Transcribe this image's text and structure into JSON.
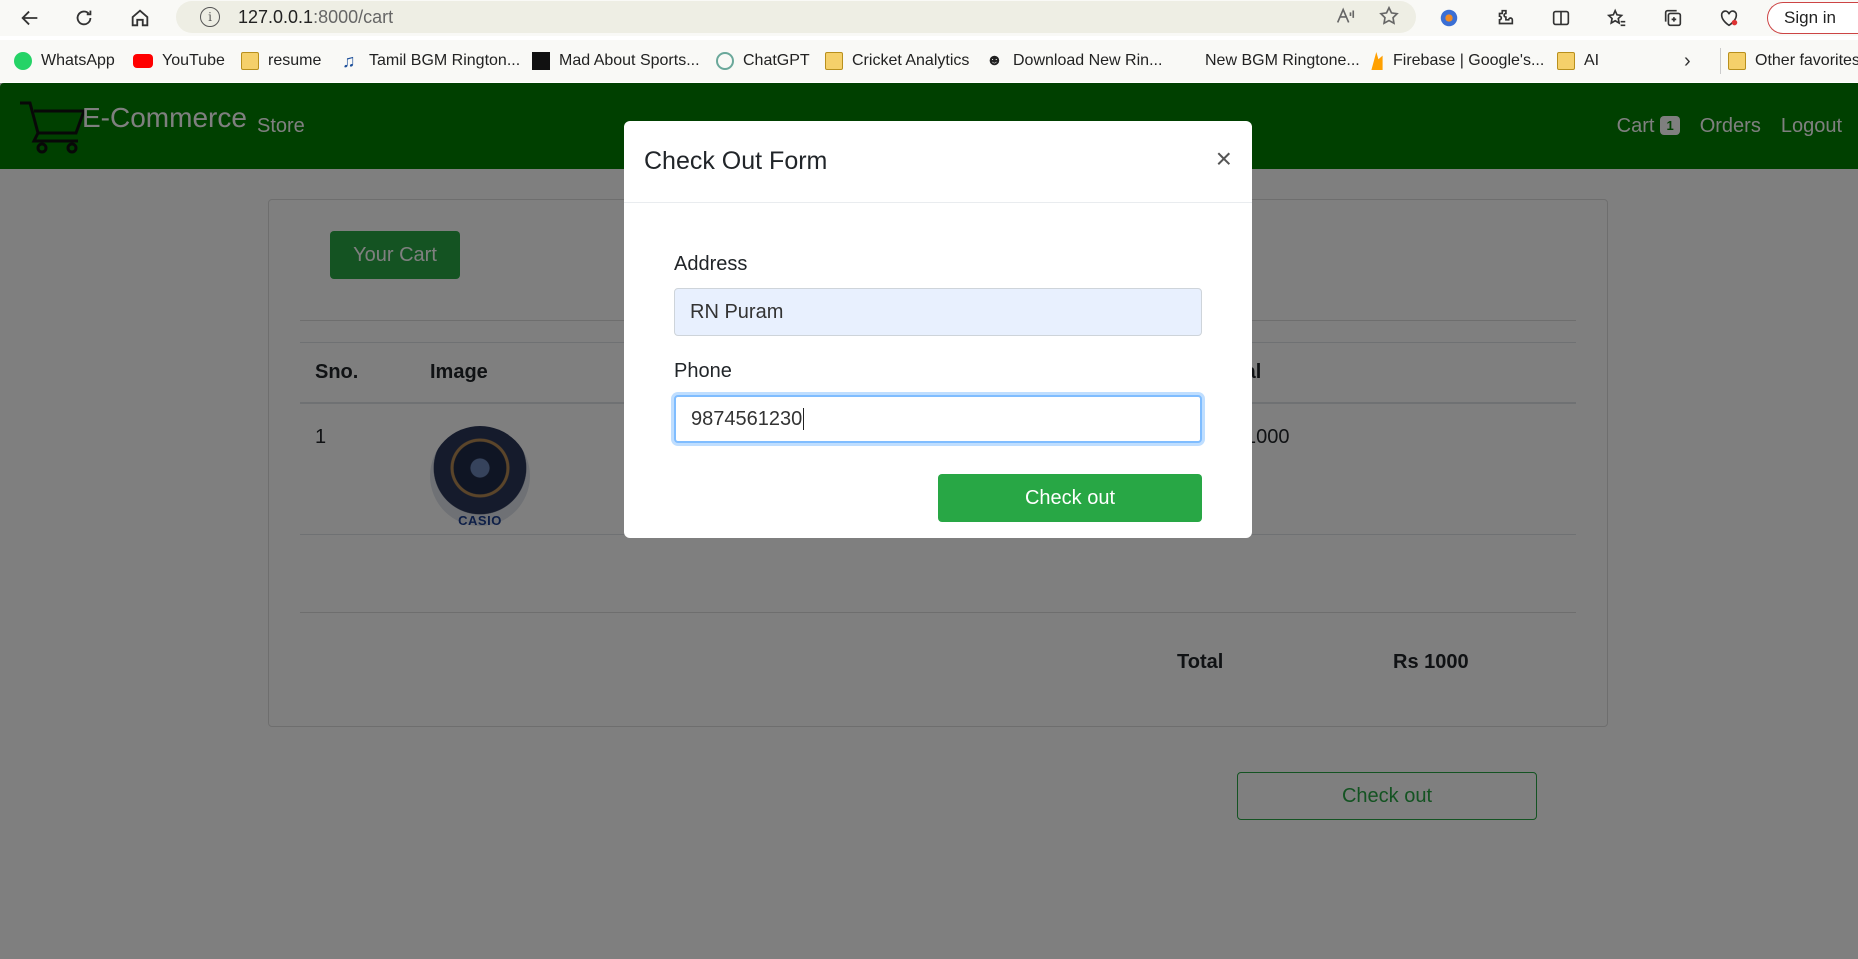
{
  "browser": {
    "url_host": "127.0.0.1",
    "url_path": ":8000/cart",
    "signin_label": "Sign in",
    "bookmarks": [
      "WhatsApp",
      "YouTube",
      "resume",
      "Tamil BGM Rington...",
      "Mad About Sports...",
      "ChatGPT",
      "Cricket Analytics",
      "Download New Rin...",
      "New BGM Ringtone...",
      "Firebase | Google's...",
      "AI"
    ],
    "other_favorites": "Other favorites"
  },
  "nav": {
    "brand": "E-Commerce",
    "store": "Store",
    "cart": "Cart",
    "cart_count": "1",
    "orders": "Orders",
    "logout": "Logout"
  },
  "cart": {
    "title_button": "Your Cart",
    "columns": {
      "sno": "Sno.",
      "image": "Image",
      "total": "Total"
    },
    "rows": [
      {
        "sno": "1",
        "image_label": "CASIO",
        "total": "Rs 1000"
      }
    ],
    "total_label": "Total",
    "total_value": "Rs 1000",
    "checkout_label": "Check out"
  },
  "modal": {
    "title": "Check Out Form",
    "close": "×",
    "address_label": "Address",
    "address_value": "RN Puram",
    "phone_label": "Phone",
    "phone_value": "9874561230",
    "submit_label": "Check out"
  }
}
